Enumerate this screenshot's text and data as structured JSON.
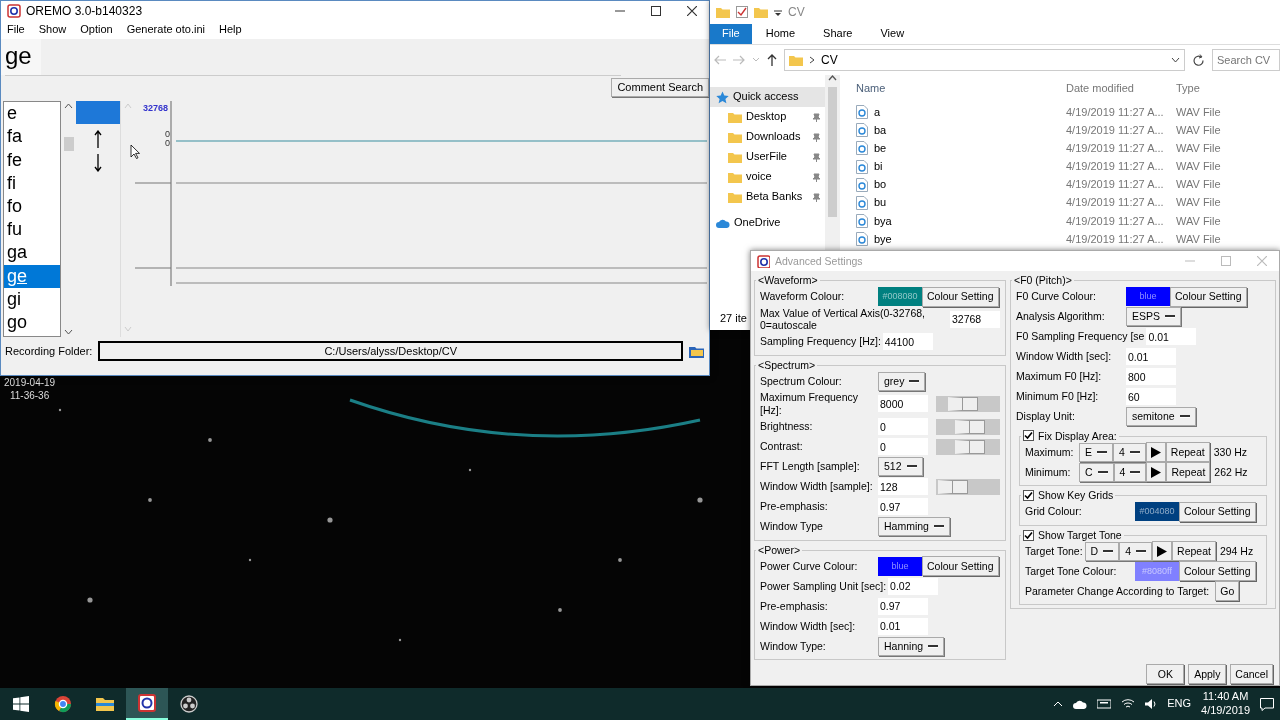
{
  "desktop": {
    "date": "2019-04-19",
    "time": "11-36-36"
  },
  "oremo": {
    "title": "OREMO 3.0-b140323",
    "menu": [
      "File",
      "Show",
      "Option",
      "Generate oto.ini",
      "Help"
    ],
    "current_alias": "ge",
    "comment_search": "Comment Search",
    "aliases": [
      {
        "label": "e",
        "selected": false
      },
      {
        "label": "fa",
        "selected": false
      },
      {
        "label": "fe",
        "selected": false
      },
      {
        "label": "fi",
        "selected": false
      },
      {
        "label": "fo",
        "selected": false
      },
      {
        "label": "fu",
        "selected": false
      },
      {
        "label": "ga",
        "selected": false
      },
      {
        "label": "ge",
        "selected": true
      },
      {
        "label": "gi",
        "selected": false
      },
      {
        "label": "go",
        "selected": false
      }
    ],
    "axis_max": "32768",
    "axis_zero": [
      "0",
      "0"
    ],
    "folder_label": "Recording Folder:",
    "folder_path": "C:/Users/alyss/Desktop/CV"
  },
  "explorer": {
    "title": "CV",
    "ribbon_tabs": [
      {
        "label": "File",
        "selected": true
      },
      {
        "label": "Home",
        "selected": false
      },
      {
        "label": "Share",
        "selected": false
      },
      {
        "label": "View",
        "selected": false
      }
    ],
    "address": "CV",
    "search_placeholder": "Search CV",
    "nav": [
      {
        "label": "Quick access",
        "kind": "quick",
        "pinned": false,
        "selected": true
      },
      {
        "label": "Desktop",
        "kind": "folder",
        "pinned": true,
        "selected": false
      },
      {
        "label": "Downloads",
        "kind": "folder",
        "pinned": true,
        "selected": false
      },
      {
        "label": "UserFile",
        "kind": "folder",
        "pinned": true,
        "selected": false
      },
      {
        "label": "voice",
        "kind": "folder",
        "pinned": true,
        "selected": false
      },
      {
        "label": "Beta Banks",
        "kind": "folder",
        "pinned": true,
        "selected": false
      },
      {
        "label": "OneDrive",
        "kind": "cloud",
        "pinned": false,
        "selected": false
      }
    ],
    "columns": [
      "Name",
      "Date modified",
      "Type"
    ],
    "files": [
      {
        "name": "a",
        "date": "4/19/2019 11:27 A...",
        "type": "WAV File"
      },
      {
        "name": "ba",
        "date": "4/19/2019 11:27 A...",
        "type": "WAV File"
      },
      {
        "name": "be",
        "date": "4/19/2019 11:27 A...",
        "type": "WAV File"
      },
      {
        "name": "bi",
        "date": "4/19/2019 11:27 A...",
        "type": "WAV File"
      },
      {
        "name": "bo",
        "date": "4/19/2019 11:27 A...",
        "type": "WAV File"
      },
      {
        "name": "bu",
        "date": "4/19/2019 11:27 A...",
        "type": "WAV File"
      },
      {
        "name": "bya",
        "date": "4/19/2019 11:27 A...",
        "type": "WAV File"
      },
      {
        "name": "bye",
        "date": "4/19/2019 11:27 A...",
        "type": "WAV File"
      }
    ],
    "status": "27 ite"
  },
  "settings": {
    "title": "Advanced Settings",
    "left_sections": [
      {
        "heading": "<Waveform>",
        "rows": [
          {
            "kind": "color",
            "label": "Waveform Colour:",
            "swatch": "#008080",
            "color": "#008080",
            "button": "Colour Setting"
          },
          {
            "kind": "entry",
            "label": "Max Value of Vertical Axis(0-32768, 0=autoscale",
            "value": "32768"
          },
          {
            "kind": "entry",
            "label": "Sampling Frequency [Hz]:",
            "value": "44100"
          }
        ]
      },
      {
        "heading": "<Spectrum>",
        "rows": [
          {
            "kind": "menu",
            "label": "Spectrum Colour:",
            "value": "grey"
          },
          {
            "kind": "slider",
            "label": "Maximum Frequency [Hz]:",
            "value": "8000",
            "level": 0.35
          },
          {
            "kind": "slider",
            "label": "Brightness:",
            "value": "0",
            "level": 0.55
          },
          {
            "kind": "slider",
            "label": "Contrast:",
            "value": "0",
            "level": 0.55
          },
          {
            "kind": "menu",
            "label": "FFT Length [sample]:",
            "value": "512"
          },
          {
            "kind": "slider",
            "label": "Window Width [sample]:",
            "value": "128",
            "level": 0.05
          },
          {
            "kind": "entry",
            "label": "Pre-emphasis:",
            "value": "0.97"
          },
          {
            "kind": "menu",
            "label": "Window Type",
            "value": "Hamming"
          }
        ]
      },
      {
        "heading": "<Power>",
        "rows": [
          {
            "kind": "color",
            "label": "Power Curve Colour:",
            "swatch": "blue",
            "color": "#0000ff",
            "button": "Colour Setting"
          },
          {
            "kind": "entry",
            "label": "Power Sampling Unit [sec]:",
            "value": "0.02"
          },
          {
            "kind": "entry",
            "label": "Pre-emphasis:",
            "value": "0.97"
          },
          {
            "kind": "entry",
            "label": "Window Width [sec]:",
            "value": "0.01"
          },
          {
            "kind": "menu",
            "label": "Window Type:",
            "value": "Hanning"
          }
        ]
      }
    ],
    "right_section": {
      "heading": "<F0 (Pitch)>",
      "rows": [
        {
          "kind": "color",
          "label": "F0 Curve Colour:",
          "swatch": "blue",
          "color": "#0000ff",
          "button": "Colour Setting"
        },
        {
          "kind": "menu",
          "label": "Analysis Algorithm:",
          "value": "ESPS"
        },
        {
          "kind": "entry",
          "label": "F0 Sampling Frequency [se",
          "value": "0.01"
        },
        {
          "kind": "entry",
          "label": "Window Width [sec]:",
          "value": "0.01"
        },
        {
          "kind": "entry",
          "label": "Maximum F0 [Hz]:",
          "value": "800"
        },
        {
          "kind": "entry",
          "label": "Minimum F0 [Hz]:",
          "value": "60"
        },
        {
          "kind": "menu",
          "label": "Display Unit:",
          "value": "semitone"
        }
      ],
      "groups": [
        {
          "label": "Fix Display Area:",
          "checked": true,
          "rows": [
            {
              "kind": "tone",
              "label": "Maximum:",
              "note": "E",
              "octave": "4",
              "button": "Repeat",
              "hz": "330 Hz"
            },
            {
              "kind": "tone",
              "label": "Minimum:",
              "note": "C",
              "octave": "4",
              "button": "Repeat",
              "hz": "262 Hz"
            }
          ]
        },
        {
          "label": "Show Key Grids",
          "checked": true,
          "rows": [
            {
              "kind": "color",
              "label": "Grid Colour:",
              "swatch": "#004080",
              "color": "#004080",
              "button": "Colour Setting"
            }
          ]
        },
        {
          "label": "Show Target Tone",
          "checked": true,
          "rows": [
            {
              "kind": "tone",
              "label": "Target Tone:",
              "note": "D",
              "octave": "4",
              "button": "Repeat",
              "hz": "294 Hz"
            },
            {
              "kind": "color",
              "label": "Target Tone Colour:",
              "swatch": "#8080ff",
              "color": "#8080ff",
              "button": "Colour Setting"
            },
            {
              "kind": "action",
              "label": "Parameter Change According to Target:",
              "button": "Go"
            }
          ]
        }
      ]
    },
    "buttons": [
      "OK",
      "Apply",
      "Cancel"
    ]
  },
  "taskbar": {
    "apps": [
      {
        "kind": "browser",
        "selected": false
      },
      {
        "kind": "folder",
        "selected": false
      },
      {
        "kind": "oremo",
        "selected": true
      },
      {
        "kind": "recorder",
        "selected": false
      }
    ],
    "language": "ENG",
    "time": "11:40 AM",
    "date": "4/19/2019"
  }
}
